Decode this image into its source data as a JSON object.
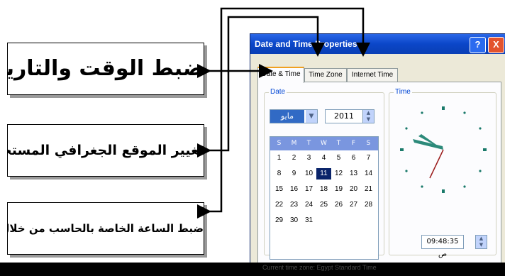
{
  "callouts": {
    "date_time_label": "ضبط الوقت والتاريخ",
    "time_zone_label": "تغيير الموقع الجغرافي المستخدم لضبط الوقت",
    "internet_time_label": "ضبط الساعة الخاصة بالحاسب من خلال شبكة الانترنت"
  },
  "window": {
    "title": "Date and Time Properties",
    "help_button": "?",
    "close_button": "X",
    "tabs": [
      "Date & Time",
      "Time Zone",
      "Internet Time"
    ],
    "date_group_label": "Date",
    "time_group_label": "Time",
    "month_value": "مايو",
    "year_value": "2011",
    "day_headers": [
      "S",
      "M",
      "T",
      "W",
      "T",
      "F",
      "S"
    ],
    "calendar_rows": [
      [
        "",
        "",
        "",
        "",
        "",
        "",
        ""
      ],
      [
        "1",
        "2",
        "3",
        "4",
        "5",
        "6",
        "7"
      ],
      [
        "8",
        "9",
        "10",
        "11",
        "12",
        "13",
        "14"
      ],
      [
        "15",
        "16",
        "17",
        "18",
        "19",
        "20",
        "21"
      ],
      [
        "22",
        "23",
        "24",
        "25",
        "26",
        "27",
        "28"
      ],
      [
        "29",
        "30",
        "31",
        "",
        "",
        "",
        ""
      ]
    ],
    "selected_day": "11",
    "time_value": "09:48:35 ص",
    "status_text": "Current time zone: Egypt Standard Time"
  },
  "colors": {
    "title_bar": "#0b46c8",
    "calendar_header": "#7a96df",
    "selected_day_bg": "#0a246a",
    "tab_accent": "#f0a020"
  }
}
